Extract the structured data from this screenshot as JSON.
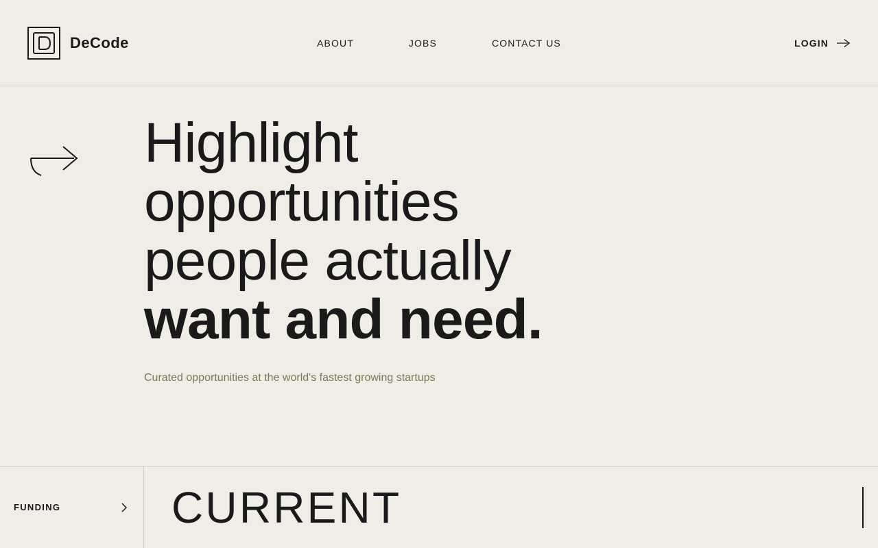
{
  "header": {
    "logo_text": "DeCode",
    "nav": {
      "about": "ABOUT",
      "jobs": "JOBS",
      "contact": "CONTACT US"
    },
    "login": "LOGIN"
  },
  "hero": {
    "heading_light": "Highlight opportunities people actually",
    "heading_bold": "want and need.",
    "subtext": "Curated opportunities at the world's fastest growing startups"
  },
  "bottom": {
    "funding_label": "FUNDING",
    "current_label": "CURRENT"
  }
}
